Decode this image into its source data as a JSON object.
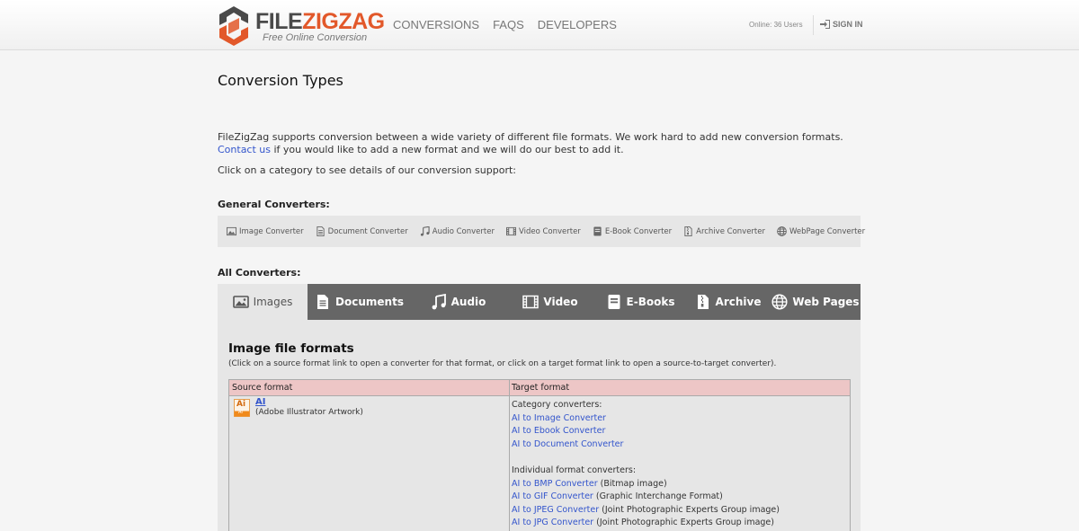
{
  "brand": {
    "name_part1": "FILE",
    "name_part2": "ZIGZAG",
    "tagline": "Free Online Conversion",
    "color_orange": "#e2582a",
    "color_gray": "#4a4a4a"
  },
  "nav": {
    "items": [
      "CONVERSIONS",
      "FAQs",
      "DEVELOPERS"
    ],
    "online": "Online: 36 Users",
    "sign_in": "SIGN IN"
  },
  "page": {
    "title": "Conversion Types",
    "intro_text": "FileZigZag supports conversion between a wide variety of different file formats. We work hard to add new conversion formats. ",
    "intro_link": "Contact us",
    "intro_text_end": " if you would like to add a new format and we will do our best to add it.",
    "instruction": "Click on a category to see details of our conversion support:",
    "general_label": "General Converters:",
    "all_label": "All Converters:"
  },
  "general_converters": [
    {
      "label": "Image Converter",
      "icon": "image-icon"
    },
    {
      "label": "Document Converter",
      "icon": "document-icon"
    },
    {
      "label": "Audio Converter",
      "icon": "music-icon"
    },
    {
      "label": "Video Converter",
      "icon": "film-icon"
    },
    {
      "label": "E-Book Converter",
      "icon": "book-icon"
    },
    {
      "label": "Archive Converter",
      "icon": "archive-icon"
    },
    {
      "label": "WebPage Converter",
      "icon": "globe-icon"
    }
  ],
  "tabs": [
    {
      "label": "Images",
      "icon": "image-icon",
      "active": true
    },
    {
      "label": "Documents",
      "icon": "document-icon"
    },
    {
      "label": "Audio",
      "icon": "music-icon"
    },
    {
      "label": "Video",
      "icon": "film-icon"
    },
    {
      "label": "E-Books",
      "icon": "book-icon"
    },
    {
      "label": "Archive",
      "icon": "archive-icon"
    },
    {
      "label": "Web Pages",
      "icon": "globe-icon"
    }
  ],
  "panel": {
    "title": "Image file formats",
    "subtitle": "(Click on a source format link to open a converter for that format, or click on a target format link to open a source-to-target converter).",
    "col_source": "Source format",
    "col_target": "Target format",
    "source": {
      "icon_label": "Ai",
      "icon_sub": "AI",
      "name": "AI",
      "desc": "(Adobe Illustrator Artwork)"
    },
    "category_heading": "Category converters:",
    "category_links": [
      "AI to Image Converter",
      "AI to Ebook Converter",
      "AI to Document Converter"
    ],
    "individual_heading": "Individual format converters:",
    "individual": [
      {
        "link": "AI to BMP Converter",
        "desc": " (Bitmap image)"
      },
      {
        "link": "AI to GIF Converter",
        "desc": " (Graphic Interchange Format)"
      },
      {
        "link": "AI to JPEG Converter",
        "desc": " (Joint Photographic Experts Group image)"
      },
      {
        "link": "AI to JPG Converter",
        "desc": " (Joint Photographic Experts Group image)"
      }
    ]
  }
}
